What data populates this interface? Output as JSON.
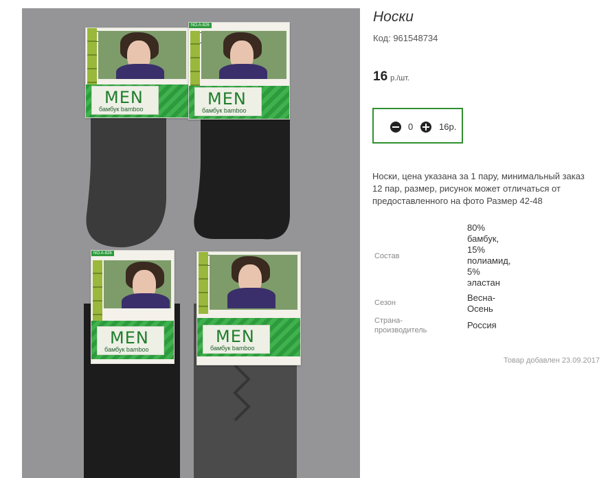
{
  "product": {
    "title": "Носки",
    "code": "Код: 961548734",
    "price_value": "16",
    "price_unit": "р./шт.",
    "quantity": "0",
    "sum": "16р.",
    "description": "Носки, цена указана за 1 пару, минимальный заказ 12 пар, размер, рисунок может отличаться от предоставленного на фото Размер 42-48",
    "properties": [
      {
        "key": "Состав",
        "value": "80%\nбамбук,\n15%\nполиамид,\n5%\nэластан"
      },
      {
        "key": "Сезон",
        "value": "Весна-\nОсень"
      },
      {
        "key": "Страна-\nпроизводитель",
        "value": "Россия"
      }
    ],
    "added": "Товар добавлен 23.09.2017"
  },
  "colors": {
    "accent": "#2f8f2f",
    "photo_bg": "#959598"
  },
  "photo": {
    "packs": [
      {
        "brand": "MEN",
        "text": "бамбук bamboo",
        "tag": ""
      },
      {
        "brand": "MEN",
        "text": "бамбук bamboo",
        "tag": "NO.A-826"
      },
      {
        "brand": "MEN",
        "text": "бамбук bamboo",
        "tag": "NO.A-826"
      },
      {
        "brand": "MEN",
        "text": "бамбук bamboo",
        "tag": ""
      }
    ]
  }
}
